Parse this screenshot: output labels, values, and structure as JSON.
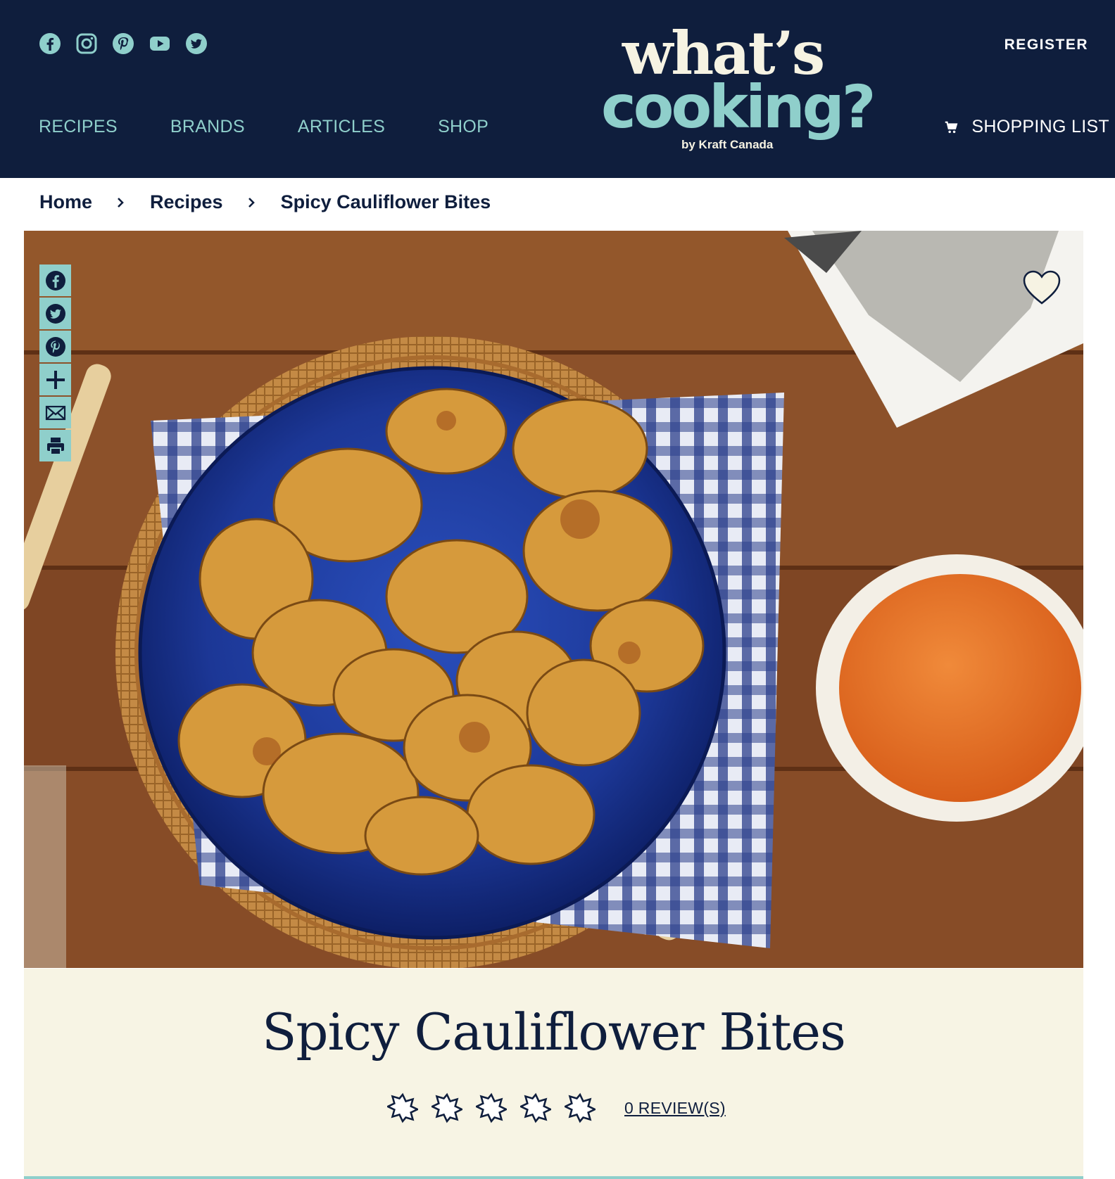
{
  "header": {
    "social_icons": [
      "facebook-icon",
      "instagram-icon",
      "pinterest-icon",
      "youtube-icon",
      "twitter-icon"
    ],
    "nav": [
      "RECIPES",
      "BRANDS",
      "ARTICLES",
      "SHOP"
    ],
    "logo": {
      "line1": "what’s",
      "line2": "cooking?",
      "byline": "by Kraft Canada"
    },
    "register": "REGISTER",
    "shopping_list": "SHOPPING LIST"
  },
  "breadcrumb": [
    "Home",
    "Recipes",
    "Spicy Cauliflower Bites"
  ],
  "share_icons": [
    "facebook-icon",
    "twitter-icon",
    "pinterest-icon",
    "plus-icon",
    "email-icon",
    "print-icon"
  ],
  "recipe": {
    "title": "Spicy Cauliflower Bites",
    "rating": 0,
    "rating_max": 5,
    "reviews_label": "0 REVIEW(S)"
  },
  "colors": {
    "navy": "#0f1e3d",
    "teal": "#8fcfcb",
    "cream": "#f7f4e4"
  }
}
